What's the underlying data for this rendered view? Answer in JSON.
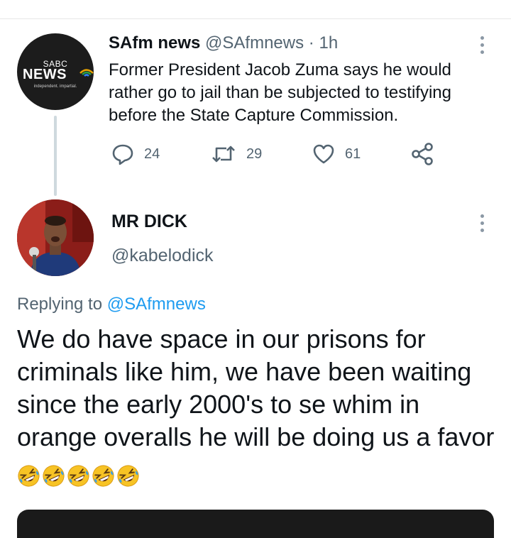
{
  "parent_tweet": {
    "avatar": {
      "brand_top": "SABC",
      "brand_main": "NEWS",
      "tagline": "independent. impartial."
    },
    "author_name": "SAfm news",
    "handle": "@SAfmnews",
    "separator": "·",
    "time": "1h",
    "text": "Former President Jacob Zuma says he would rather go to jail than be subjected to testifying before the State Capture Commission.",
    "actions": {
      "reply": {
        "icon": "reply-icon",
        "count": "24"
      },
      "retweet": {
        "icon": "retweet-icon",
        "count": "29"
      },
      "like": {
        "icon": "heart-icon",
        "count": "61"
      },
      "share": {
        "icon": "share-icon"
      }
    }
  },
  "reply_tweet": {
    "author_name": "MR DICK",
    "handle": "@kabelodick",
    "replying_label": "Replying to",
    "replying_to": "@SAfmnews",
    "text": "We do have space in our prisons for criminals like him, we have been waiting since the early 2000's to se whim in orange overalls he will be doing us a favor",
    "emojis": [
      "rolling-on-floor-laughing",
      "rolling-on-floor-laughing",
      "rolling-on-floor-laughing",
      "rolling-on-floor-laughing",
      "rolling-on-floor-laughing"
    ]
  },
  "colors": {
    "text_primary": "#0f1419",
    "text_secondary": "#536471",
    "link": "#1d9bf0",
    "thread_line": "#cfd9de"
  }
}
